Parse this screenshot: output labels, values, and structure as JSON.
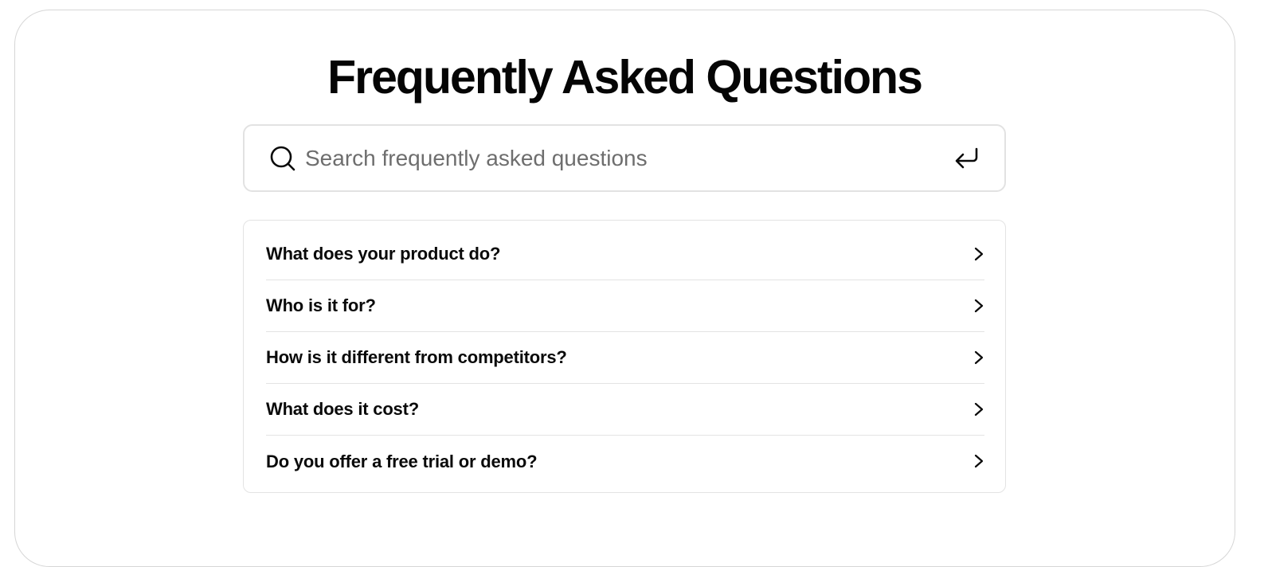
{
  "page": {
    "title": "Frequently Asked Questions"
  },
  "search": {
    "value": "",
    "placeholder": "Search frequently asked questions",
    "icon": "search-icon",
    "submit_icon": "enter-icon"
  },
  "faq": {
    "items": [
      {
        "question": "What does your product do?",
        "icon": "chevron-right-icon"
      },
      {
        "question": "Who is it for?",
        "icon": "chevron-right-icon"
      },
      {
        "question": "How is it different from competitors?",
        "icon": "chevron-right-icon"
      },
      {
        "question": "What does it cost?",
        "icon": "chevron-right-icon"
      },
      {
        "question": "Do you offer a free trial or demo?",
        "icon": "chevron-right-icon"
      }
    ]
  },
  "colors": {
    "text": "#0a0a0a",
    "placeholder": "#6e6e6e",
    "border": "#e3e3e3",
    "background": "#ffffff"
  }
}
